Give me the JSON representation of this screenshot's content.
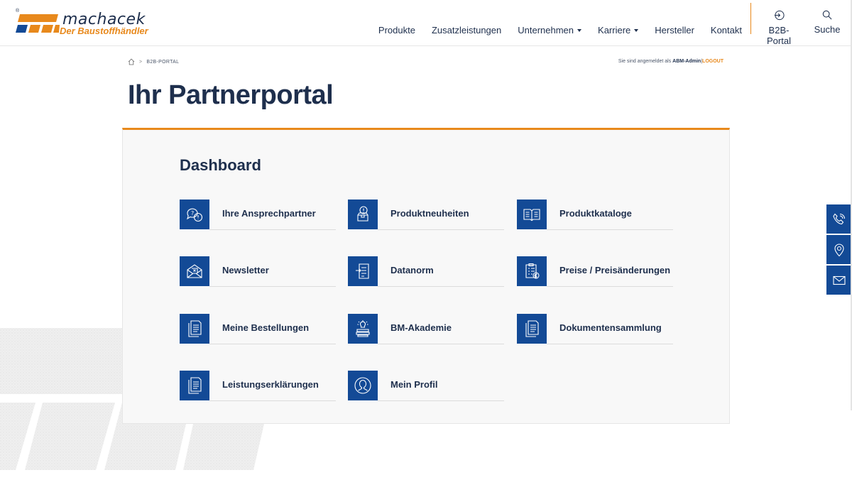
{
  "brand": {
    "name": "machacek",
    "tagline": "Der Baustoffhändler",
    "registered": "®",
    "colors": {
      "navy": "#1e2f4d",
      "blue": "#134a96",
      "orange": "#e8891c"
    }
  },
  "nav": {
    "items": [
      {
        "label": "Produkte",
        "dropdown": false
      },
      {
        "label": "Zusatzleistungen",
        "dropdown": false
      },
      {
        "label": "Unternehmen",
        "dropdown": true
      },
      {
        "label": "Karriere",
        "dropdown": true
      },
      {
        "label": "Hersteller",
        "dropdown": false
      },
      {
        "label": "Kontakt",
        "dropdown": false
      }
    ],
    "b2b_label": "B2B-Portal",
    "search_label": "Suche"
  },
  "breadcrumb": {
    "home_icon": "home-icon",
    "separator": ">",
    "current": "B2B-PORTAL"
  },
  "login": {
    "prefix": "Sie sind angemeldet als",
    "user": "ABM-Admin",
    "divider": "|",
    "logout": "LOGOUT"
  },
  "page": {
    "title": "Ihr Partnerportal"
  },
  "dashboard": {
    "title": "Dashboard",
    "tiles": [
      {
        "label": "Ihre Ansprechpartner",
        "icon": "contact-persons-icon"
      },
      {
        "label": "Produktneuheiten",
        "icon": "new-products-icon"
      },
      {
        "label": "Produktkataloge",
        "icon": "catalog-icon"
      },
      {
        "label": "Newsletter",
        "icon": "newsletter-icon"
      },
      {
        "label": "Datanorm",
        "icon": "datanorm-icon"
      },
      {
        "label": "Preise / Preisänderungen",
        "icon": "price-list-icon"
      },
      {
        "label": "Meine Bestellungen",
        "icon": "orders-icon"
      },
      {
        "label": "BM-Akademie",
        "icon": "academy-icon"
      },
      {
        "label": "Dokumentensammlung",
        "icon": "documents-icon"
      },
      {
        "label": "Leistungserklärungen",
        "icon": "declarations-icon"
      },
      {
        "label": "Mein Profil",
        "icon": "profile-icon"
      }
    ]
  },
  "side_actions": [
    {
      "icon": "phone-icon"
    },
    {
      "icon": "location-icon"
    },
    {
      "icon": "mail-icon"
    }
  ]
}
